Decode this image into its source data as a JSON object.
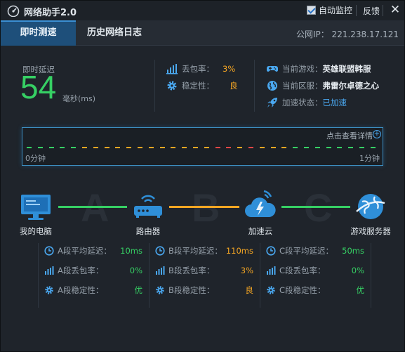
{
  "app": {
    "title": "网络助手2.0",
    "auto_monitor_label": "自动监控",
    "auto_monitor_checked": true,
    "feedback_label": "反馈",
    "close_label": "✕"
  },
  "tabs": [
    {
      "label": "即时测速",
      "active": true
    },
    {
      "label": "历史网络日志",
      "active": false
    }
  ],
  "public_ip": "公网IP： 221.238.17.121",
  "latency": {
    "label": "即时延迟",
    "value": "54",
    "unit": "毫秒(ms)"
  },
  "quality": {
    "loss_label": "丢包率：",
    "loss_value": "3%",
    "stability_label": "稳定性：",
    "stability_value": "良"
  },
  "game": {
    "game_label": "当前游戏：",
    "game_value": "英雄联盟韩服",
    "region_label": "当前区服：",
    "region_value": "弗雷尔卓德之心",
    "accel_label": "加速状态：",
    "accel_value": "已加速"
  },
  "graph": {
    "detail_link": "点击查看详情",
    "start_label": "0分钟",
    "end_label": "1分钟",
    "dash_colors": [
      "#36d064",
      "#36d064",
      "#36d064",
      "#36d064",
      "#36d064",
      "#f5a623",
      "#f5a623",
      "#f5a623",
      "#f5a623",
      "#f5a623",
      "#f5a623",
      "#f5a623",
      "#f5a623",
      "#f5a623",
      "#f5a623",
      "#f5a623",
      "#f5a623",
      "#e04646",
      "#e04646",
      "#f5a623",
      "#e04646",
      "#f5a623",
      "#f5a623",
      "#f5a623",
      "#36d064",
      "#36d064",
      "#36d064",
      "#36d064",
      "#36d064",
      "#36d064",
      "#36d064",
      "#36d064"
    ]
  },
  "route": {
    "nodes": [
      {
        "label": "我的电脑",
        "icon": "computer-icon"
      },
      {
        "label": "路由器",
        "icon": "router-icon"
      },
      {
        "label": "加速云",
        "icon": "cloud-icon"
      },
      {
        "label": "游戏服务器",
        "icon": "server-globe-icon"
      }
    ],
    "segment_letters": [
      "A",
      "B",
      "C"
    ],
    "segment_colors": [
      "#36d064",
      "#f5a623",
      "#36d064"
    ]
  },
  "segments": [
    {
      "latency_label": "A段平均延迟：",
      "latency_value": "10ms",
      "loss_label": "A段丢包率：",
      "loss_value": "0%",
      "stability_label": "A段稳定性：",
      "stability_value": "优"
    },
    {
      "latency_label": "B段平均延迟：",
      "latency_value": "110ms",
      "loss_label": "B段丢包率：",
      "loss_value": "3%",
      "stability_label": "B段稳定性：",
      "stability_value": "良"
    },
    {
      "latency_label": "C段平均延迟：",
      "latency_value": "50ms",
      "loss_label": "C段丢包率：",
      "loss_value": "0%",
      "stability_label": "C段稳定性：",
      "stability_value": "优"
    }
  ],
  "colors": {
    "good": "#36d064",
    "warn": "#f5a623",
    "accent": "#4aa8f0",
    "bad": "#e04646"
  }
}
